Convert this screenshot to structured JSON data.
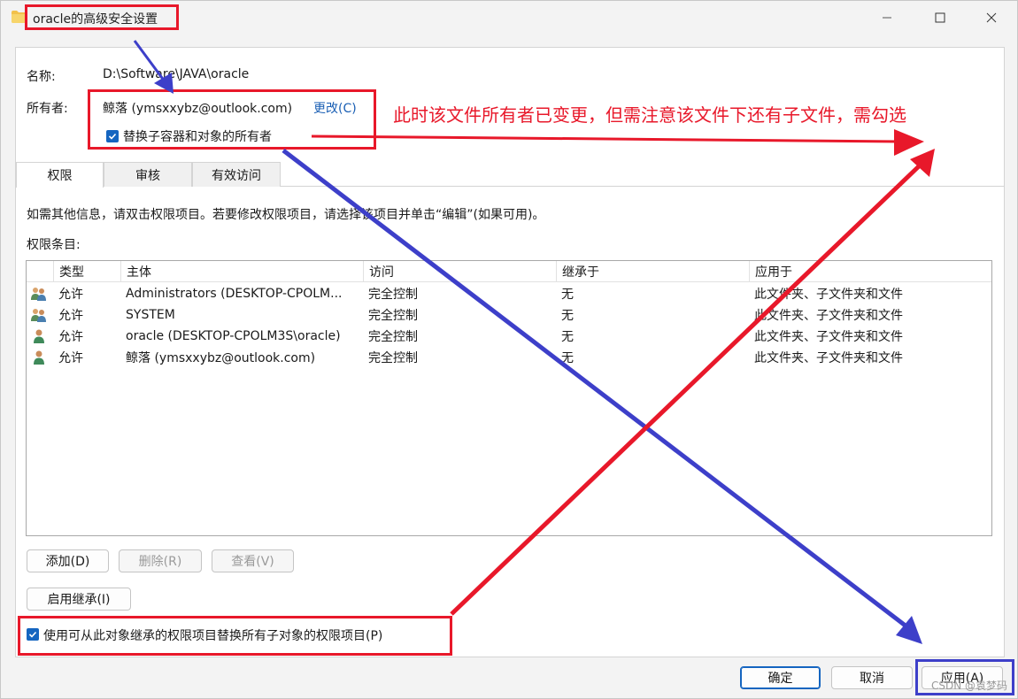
{
  "window": {
    "title": "oracle的高级安全设置",
    "controls": {
      "minimize": "—",
      "maximize": "☐",
      "close": "✕"
    }
  },
  "fields": {
    "name_label": "名称:",
    "name_value": "D:\\Software\\JAVA\\oracle",
    "owner_label": "所有者:",
    "owner_value": "鲸落 (ymsxxybz@outlook.com)",
    "change_link": "更改(C)",
    "replace_owner_checkbox": "替换子容器和对象的所有者",
    "replace_owner_checked": true
  },
  "tabs": [
    {
      "label": "权限",
      "active": true
    },
    {
      "label": "审核",
      "active": false
    },
    {
      "label": "有效访问",
      "active": false
    }
  ],
  "info_text": "如需其他信息，请双击权限项目。若要修改权限项目，请选择该项目并单击“编辑”(如果可用)。",
  "entries_label": "权限条目:",
  "table": {
    "columns": [
      "类型",
      "主体",
      "访问",
      "继承于",
      "应用于"
    ],
    "rows": [
      {
        "icon": "group-users-icon",
        "type": "允许",
        "principal": "Administrators (DESKTOP-CPOLM...",
        "access": "完全控制",
        "inherited": "无",
        "applies": "此文件夹、子文件夹和文件"
      },
      {
        "icon": "group-users-icon",
        "type": "允许",
        "principal": "SYSTEM",
        "access": "完全控制",
        "inherited": "无",
        "applies": "此文件夹、子文件夹和文件"
      },
      {
        "icon": "user-icon",
        "type": "允许",
        "principal": "oracle (DESKTOP-CPOLM3S\\oracle)",
        "access": "完全控制",
        "inherited": "无",
        "applies": "此文件夹、子文件夹和文件"
      },
      {
        "icon": "user-icon",
        "type": "允许",
        "principal": "鲸落 (ymsxxybz@outlook.com)",
        "access": "完全控制",
        "inherited": "无",
        "applies": "此文件夹、子文件夹和文件"
      }
    ]
  },
  "buttons": {
    "add": "添加(D)",
    "remove": "删除(R)",
    "view": "查看(V)",
    "enable_inheritance": "启用继承(I)",
    "ok": "确定",
    "cancel": "取消",
    "apply": "应用(A)"
  },
  "replace_child_checkbox": "使用可从此对象继承的权限项目替换所有子对象的权限项目(P)",
  "replace_child_checked": true,
  "annotation": {
    "text": "此时该文件所有者已变更，但需注意该文件下还有子文件，需勾选",
    "color": "#e8182a",
    "arrow_blue": "#3d3fc9"
  },
  "watermark": "CSDN @袁梦码",
  "colors": {
    "accent": "#1565c0",
    "link": "#1a5fb4"
  }
}
